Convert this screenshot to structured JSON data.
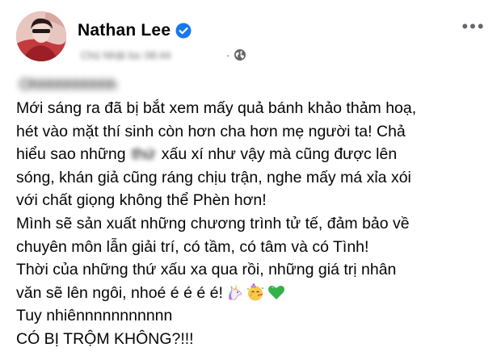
{
  "author": {
    "name": "Nathan Lee",
    "blurred_meta": "Chủ Nhật lúc 08:44"
  },
  "post": {
    "blurred_name": "Ohhhhhhhhhh",
    "lines": [
      "Mới sáng ra đã bị bắt xem mấy quả bánh khảo thảm hoạ,",
      "hét vào mặt thí sinh còn hơn cha hơn mẹ người ta! Chả",
      {
        "before": "hiểu sao những ",
        "blurred": "thứ",
        "after": " xấu xí như vậy mà cũng được lên"
      },
      "sóng, khán giả cũng ráng chịu trận, nghe mấy má xỉa xói",
      "với chất giọng không thể Phèn hơn!",
      "Mình sẽ sản xuất những chương trình tử tế, đảm bảo  về",
      "chuyên môn lẫn giải trí, có tầm, có tâm và có Tình!",
      "Thời của những thứ xấu xa qua rồi, những giá trị nhân",
      {
        "text": "văn sẽ lên ngôi, nhoé é é é é!",
        "emojis": [
          "unicorn-emoji",
          "party-face-emoji",
          "green-heart-emoji"
        ]
      },
      "Tuy nhiênnnnnnnnnnn",
      "CÓ BỊ TRỘM KHÔNG?!!!"
    ]
  },
  "icons": {
    "verified": "verified-badge-icon",
    "globe": "globe-icon",
    "more": "more-options-icon"
  },
  "colors": {
    "verified_blue": "#1877f2",
    "meta_gray": "#65676b",
    "text": "#050505"
  }
}
